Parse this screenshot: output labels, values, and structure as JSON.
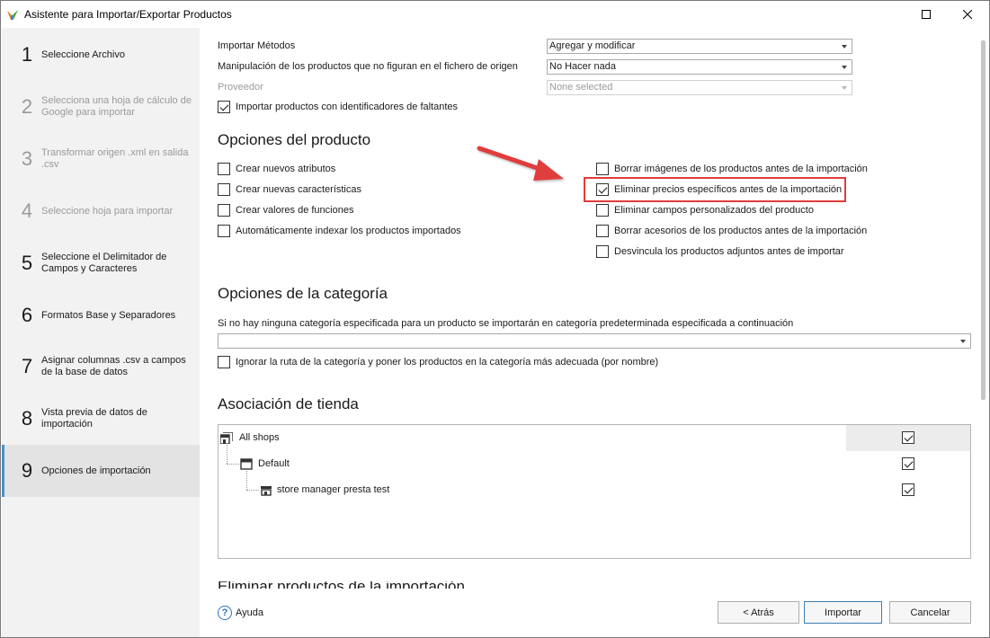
{
  "window": {
    "title": "Asistente para Importar/Exportar Productos"
  },
  "steps": [
    {
      "num": "1",
      "label": "Seleccione Archivo",
      "state": "normal"
    },
    {
      "num": "2",
      "label": "Selecciona una hoja de cálculo de Google para importar",
      "state": "disabled"
    },
    {
      "num": "3",
      "label": "Transformar origen .xml en salida .csv",
      "state": "disabled"
    },
    {
      "num": "4",
      "label": "Seleccione hoja para importar",
      "state": "disabled"
    },
    {
      "num": "5",
      "label": "Seleccione el Delimitador de Campos y Caracteres",
      "state": "normal"
    },
    {
      "num": "6",
      "label": "Formatos Base y Separadores",
      "state": "normal"
    },
    {
      "num": "7",
      "label": "Asignar columnas .csv a campos de la base de datos",
      "state": "normal"
    },
    {
      "num": "8",
      "label": "Vista previa de datos de importación",
      "state": "normal"
    },
    {
      "num": "9",
      "label": "Opciones de importación",
      "state": "active"
    }
  ],
  "top": {
    "import_methods_label": "Importar Métodos",
    "import_methods_value": "Agregar y modificar",
    "handling_label": "Manipulación de los productos que no figuran en el fichero de origen",
    "handling_value": "No Hacer nada",
    "supplier_label": "Proveedor",
    "supplier_value": "None selected",
    "import_missing_ids_label": "Importar productos con identificadores de faltantes"
  },
  "product_options": {
    "title": "Opciones del producto",
    "left": [
      {
        "label": "Crear nuevos atributos",
        "checked": false
      },
      {
        "label": "Crear nuevas características",
        "checked": false
      },
      {
        "label": "Crear valores de funciones",
        "checked": false
      },
      {
        "label": "Automáticamente indexar los productos importados",
        "checked": false
      }
    ],
    "right": [
      {
        "label": "Borrar imágenes de los productos antes de la importación",
        "checked": false
      },
      {
        "label": "Eliminar precios específicos antes de la importación",
        "checked": true
      },
      {
        "label": "Eliminar campos personalizados del producto",
        "checked": false
      },
      {
        "label": "Borrar acesorios de los productos antes de la importación",
        "checked": false
      },
      {
        "label": "Desvincula los productos adjuntos antes de importar",
        "checked": false
      }
    ]
  },
  "category_options": {
    "title": "Opciones de la categoría",
    "default_category_label": "Si no hay ninguna categoría especificada para un producto se importarán en categoría predeterminada especificada a continuación",
    "default_category_value": "",
    "ignore_path_label": "Ignorar la ruta de la categoría y poner los productos en la categoría más adecuada (por nombre)"
  },
  "store_association": {
    "title": "Asociación de tienda",
    "rows": [
      {
        "name": "All shops",
        "checked": true
      },
      {
        "name": "Default",
        "checked": true
      },
      {
        "name": "store manager presta test",
        "checked": true
      }
    ]
  },
  "cut_section_title": "Eliminar productos de la importación",
  "footer": {
    "help_label": "Ayuda",
    "back_label": "< Atrás",
    "import_label": "Importar",
    "cancel_label": "Cancelar"
  },
  "colors": {
    "highlight": "#e03c3c",
    "arrow": "#e03c3c",
    "accent": "#3c7fb1"
  }
}
